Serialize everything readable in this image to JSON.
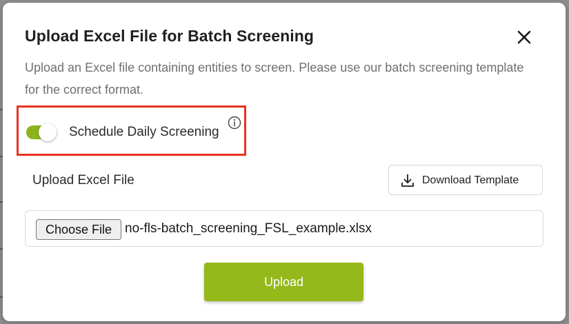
{
  "dialog": {
    "title": "Upload Excel File for Batch Screening",
    "description": "Upload an Excel file containing entities to screen. Please use our batch screening template for the correct format.",
    "close_icon": "close-icon"
  },
  "schedule": {
    "label": "Schedule Daily Screening",
    "enabled": true,
    "info_icon": "info-icon"
  },
  "upload": {
    "label": "Upload Excel File",
    "download_button": "Download Template",
    "download_icon": "download-icon",
    "choose_button": "Choose File",
    "file_name": "no-fls-batch_screening_FSL_example.xlsx",
    "submit_button": "Upload"
  },
  "colors": {
    "accent": "#95b81a",
    "toggle_on": "#8cb31a",
    "highlight": "#e8321f"
  }
}
